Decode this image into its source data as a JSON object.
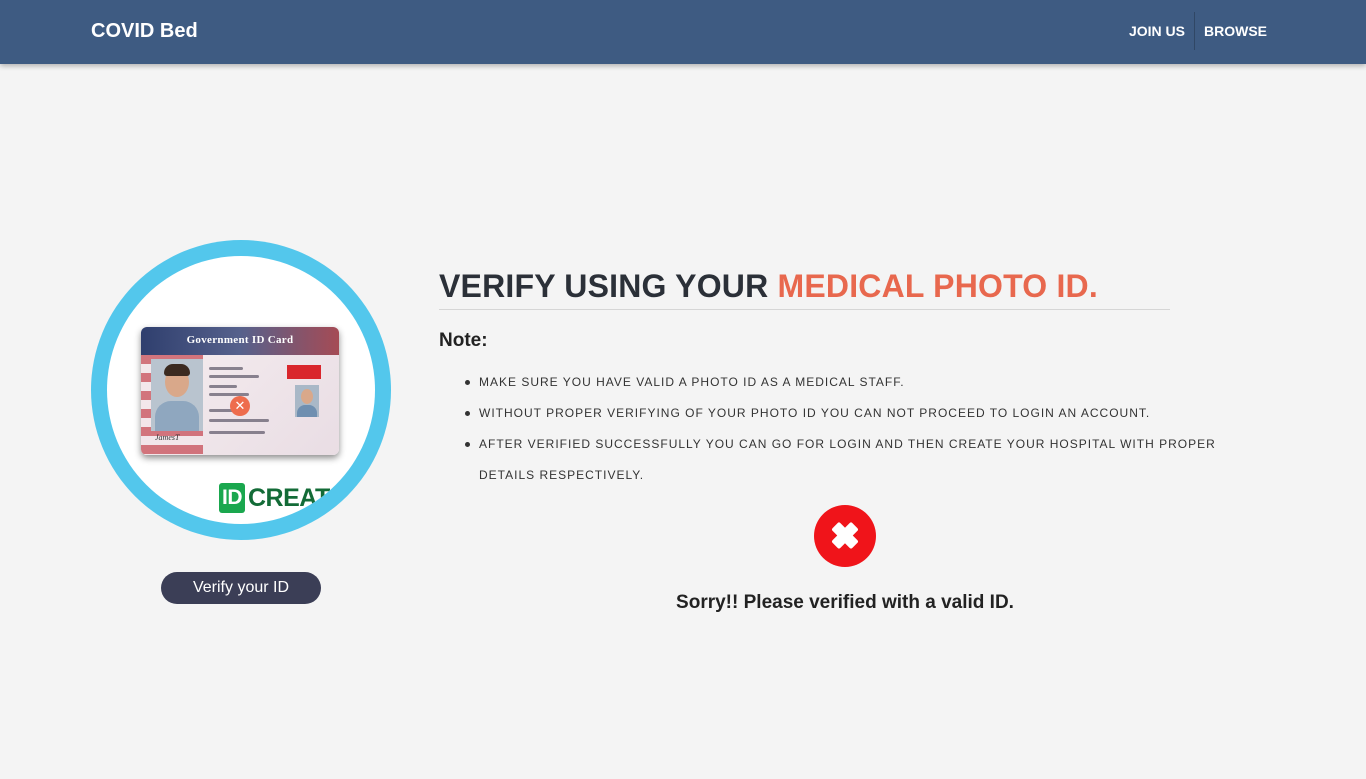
{
  "navbar": {
    "brand": "COVID Bed",
    "links": [
      "JOIN US",
      "BROWSE"
    ],
    "background": "#3e5b82"
  },
  "id_image": {
    "card_title": "Government ID Card",
    "signature": "JamesT",
    "brand_badge_id": "ID",
    "brand_badge_text": "CREAT",
    "ring_color": "#53c7ec"
  },
  "verify_button": {
    "label": "Verify your ID"
  },
  "heading": {
    "prefix": "VERIFY USING YOUR ",
    "highlight": "MEDICAL PHOTO ID.",
    "accent_color": "#e8684e"
  },
  "note": {
    "label": "Note:",
    "items": [
      "MAKE SURE YOU HAVE VALID A PHOTO ID AS A MEDICAL STAFF.",
      "WITHOUT PROPER VERIFYING OF YOUR PHOTO ID YOU CAN NOT PROCEED TO LOGIN AN ACCOUNT.",
      "AFTER VERIFIED SUCCESSFULLY YOU CAN GO FOR LOGIN AND THEN CREATE YOUR HOSPITAL WITH PROPER DETAILS RESPECTIVELY."
    ]
  },
  "result": {
    "icon": "error-x-icon",
    "message": "Sorry!! Please verified with a valid ID.",
    "color": "#f0141a"
  }
}
